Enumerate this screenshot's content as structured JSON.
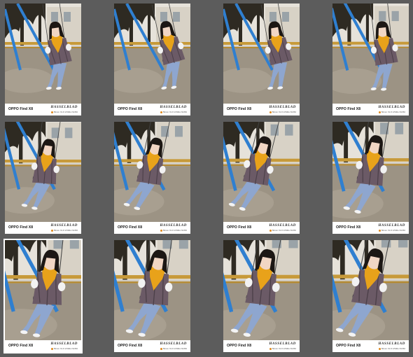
{
  "footer": {
    "model": "OPPO Find X8",
    "brand": "HASSELBLAD",
    "brand_sub": "50mm f/1.8 1/500s ISO50"
  },
  "photos": [
    {
      "id": 1,
      "selected": false
    },
    {
      "id": 2,
      "selected": false
    },
    {
      "id": 3,
      "selected": false
    },
    {
      "id": 4,
      "selected": false
    },
    {
      "id": 5,
      "selected": false
    },
    {
      "id": 6,
      "selected": false
    },
    {
      "id": 7,
      "selected": false
    },
    {
      "id": 8,
      "selected": false
    },
    {
      "id": 9,
      "selected": true
    },
    {
      "id": 10,
      "selected": false
    },
    {
      "id": 11,
      "selected": false
    },
    {
      "id": 12,
      "selected": false
    }
  ],
  "colors": {
    "background": "#5c5c5c",
    "swing_frame": "#2f7fd0",
    "scarf": "#e8a21a",
    "jacket": "#6b5a66",
    "jeans": "#8ea6cf",
    "ground": "#9c9384",
    "trees": "#2e2a22",
    "brand_dot": "#e08a1e"
  }
}
